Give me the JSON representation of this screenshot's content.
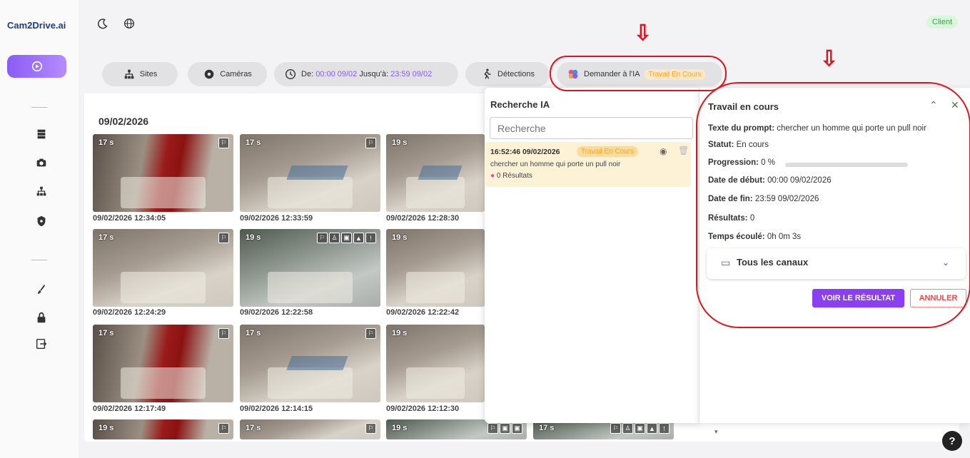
{
  "app": {
    "logo": "Cam2Drive.ai",
    "client_badge": "Client"
  },
  "filters": {
    "sites": "Sites",
    "cameras": "Caméras",
    "date_from_label": "De:",
    "date_from": "00:00 09/02",
    "date_to_label": "Jusqu'à:",
    "date_to": "23:59 09/02",
    "detections": "Détections",
    "ask_ai": "Demander à l'IA",
    "ask_ai_status": "Travail En Cours"
  },
  "gallery": {
    "date_heading": "09/02/2026",
    "items": [
      {
        "duration": "17 s",
        "caption": "09/02/2026 12:34:05"
      },
      {
        "duration": "17 s",
        "caption": "09/02/2026 12:33:59"
      },
      {
        "duration": "19 s",
        "caption": "09/02/2026 12:28:30"
      },
      {
        "duration": "17 s",
        "caption": "09/02/2026 12:24:29"
      },
      {
        "duration": "19 s",
        "caption": "09/02/2026 12:22:58"
      },
      {
        "duration": "19 s",
        "caption": "09/02/2026 12:22:42"
      },
      {
        "duration": "17 s",
        "caption": "09/02/2026 12:17:49"
      },
      {
        "duration": "17 s",
        "caption": "09/02/2026 12:14:15"
      },
      {
        "duration": "19 s",
        "caption": "09/02/2026 12:12:30"
      },
      {
        "duration": "19 s",
        "caption": ""
      },
      {
        "duration": "17 s",
        "caption": ""
      },
      {
        "duration": "19 s",
        "caption": ""
      },
      {
        "duration": "17 s",
        "caption": ""
      }
    ]
  },
  "search_panel": {
    "title": "Recherche IA",
    "placeholder": "Recherche",
    "result": {
      "time": "16:52:46 09/02/2026",
      "status": "Travail En Cours",
      "prompt": "chercher un homme qui porte un pull noir",
      "results": "0 Résultats"
    }
  },
  "job_panel": {
    "title": "Travail en cours",
    "prompt_label": "Texte du prompt:",
    "prompt_value": "chercher un homme qui porte un pull noir",
    "status_label": "Statut:",
    "status_value": "En cours",
    "progress_label": "Progression:",
    "progress_value": "0 %",
    "progress_fraction": 0,
    "start_label": "Date de début:",
    "start_value": "00:00 09/02/2026",
    "end_label": "Date de fin:",
    "end_value": "23:59 09/02/2026",
    "results_label": "Résultats:",
    "results_value": "0",
    "elapsed_label": "Temps écoulé:",
    "elapsed_value": "0h 0m 3s",
    "channels": "Tous les canaux",
    "view_button": "VOIR LE RÉSULTAT",
    "cancel_button": "ANNULER"
  },
  "colors": {
    "accent": "#8a3ff0",
    "annotation": "#e0141c",
    "status_orange": "#f5a623"
  }
}
